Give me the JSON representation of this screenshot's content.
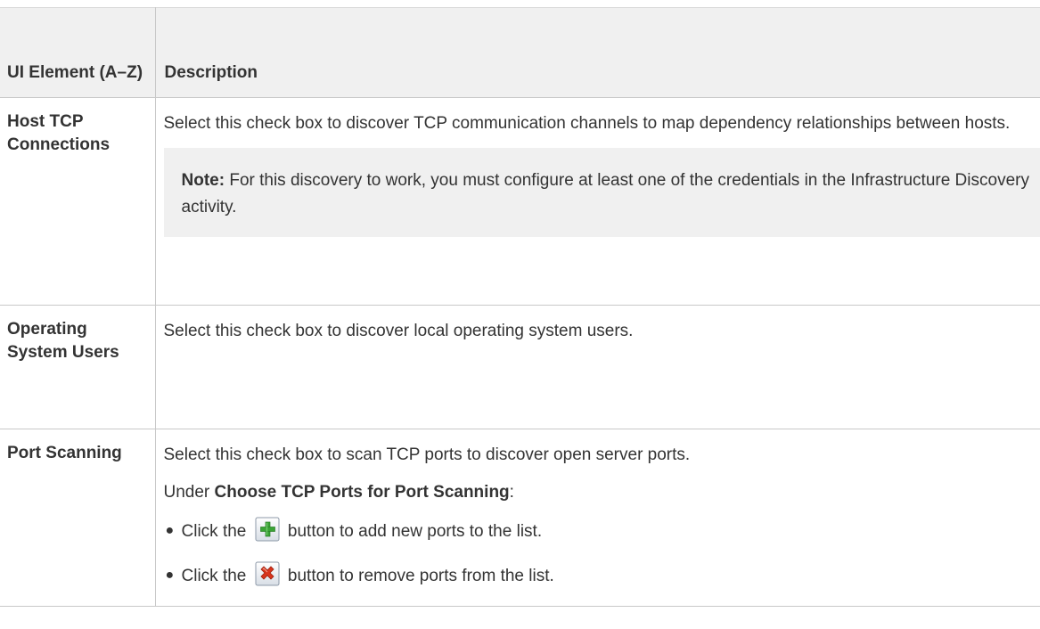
{
  "table": {
    "headers": {
      "element": "UI Element (A–Z)",
      "description": "Description"
    },
    "rows": [
      {
        "name": "Host TCP Connections",
        "description": "Select this check box to discover TCP communication channels to map dependency relationships between hosts.",
        "note_label": "Note:",
        "note_text": " For this discovery to work, you must configure at least one of the credentials in the Infrastructure Discovery activity."
      },
      {
        "name": "Operating System Users",
        "description": "Select this check box to discover local operating system users."
      },
      {
        "name": "Port Scanning",
        "description": "Select this check box to scan TCP ports to discover open server ports.",
        "under_prefix": "Under ",
        "under_bold": "Choose TCP Ports for Port Scanning",
        "under_suffix": ":",
        "bullets": [
          {
            "prefix": "Click the",
            "icon": "add-icon",
            "suffix": "button to add new ports to the list."
          },
          {
            "prefix": "Click the",
            "icon": "remove-icon",
            "suffix": "button to remove ports from the list."
          }
        ]
      }
    ]
  },
  "colors": {
    "header_bg": "#f0f0f0",
    "note_bg": "#f0f0f0",
    "border": "#c8c8c8",
    "text": "#333333",
    "add_icon_green": "#3aa335",
    "remove_icon_red": "#d9341c"
  }
}
